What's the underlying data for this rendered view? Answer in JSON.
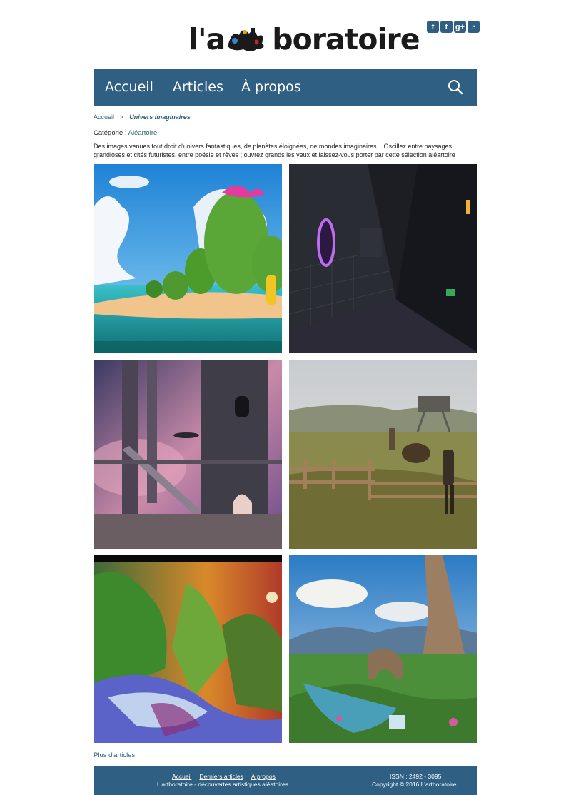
{
  "header": {
    "logo_prefix": "l'a",
    "logo_suffix": "boratoire",
    "social": [
      {
        "name": "facebook-icon",
        "glyph": "f",
        "color": "#2f5f82"
      },
      {
        "name": "twitter-icon",
        "glyph": "t",
        "color": "#2f5f82"
      },
      {
        "name": "google-plus-icon",
        "glyph": "g+",
        "color": "#2f5f82"
      },
      {
        "name": "rss-icon",
        "glyph": "◔",
        "color": "#2f5f82"
      }
    ]
  },
  "nav": {
    "items": [
      "Accueil",
      "Articles",
      "À propos"
    ],
    "search_icon": "magnifier",
    "background": "#2f5f82"
  },
  "breadcrumb": {
    "home": "Accueil",
    "separator": ">",
    "current": "Univers imaginaires"
  },
  "category": {
    "label": "Catégorie :",
    "value": "Aléartoire",
    "suffix": "."
  },
  "description": "Des images venues tout droit d'univers fantastiques, de planètes éloignées, de mondes imaginaires... Oscillez entre paysages grandioses et cités futuristes, entre poésie et rêves ; ouvrez grands les yeux et laissez-vous porter par cette sélection aléartoire !",
  "more_link": "Plus d'articles",
  "footer": {
    "links": [
      "Accueil",
      "Derniers articles",
      "À propos"
    ],
    "tagline": "L'artboratoire - découvertes artistiques aléatoires",
    "issn": "ISSN : 2492 - 3095",
    "copyright": "Copyright © 2016 L'artboratoire"
  }
}
